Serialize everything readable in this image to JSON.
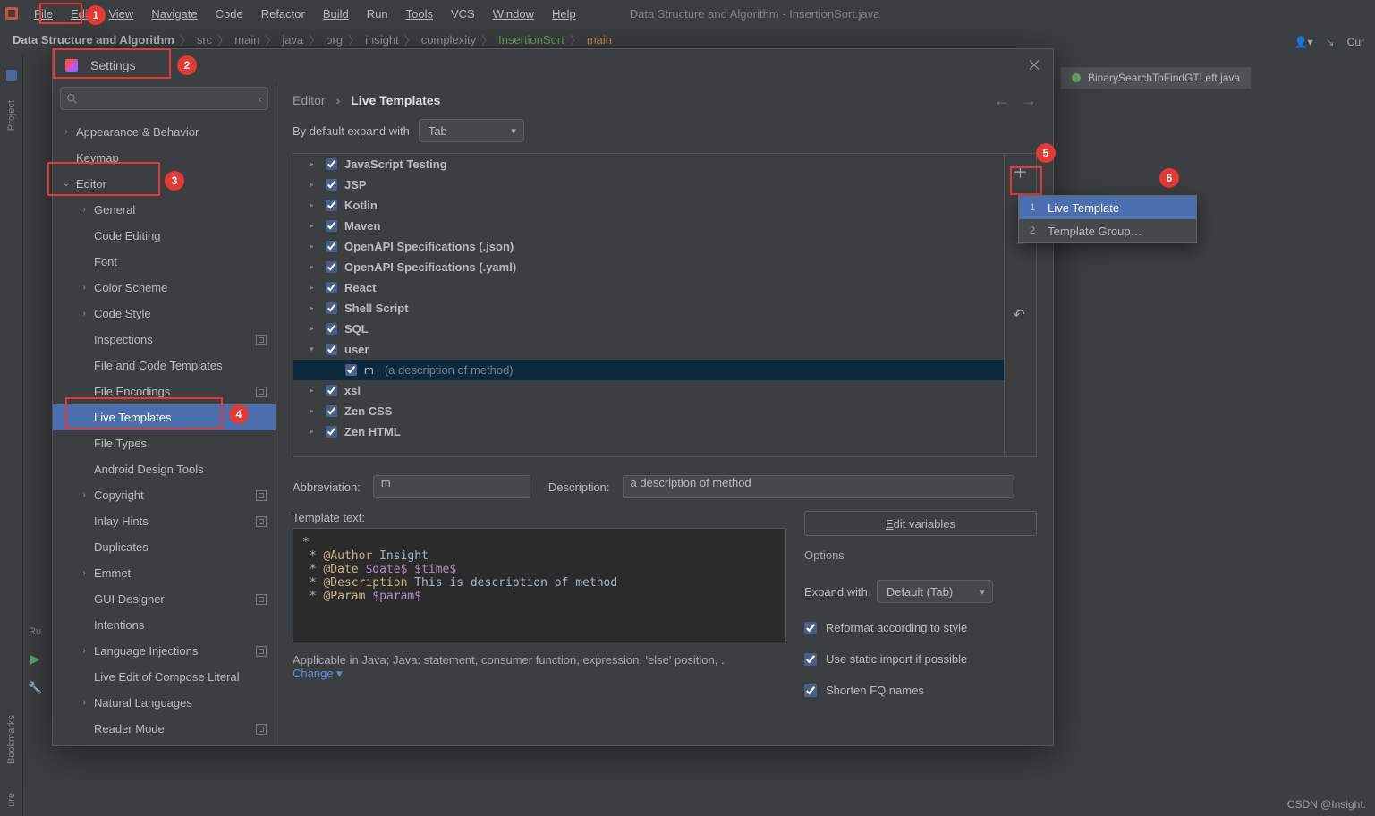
{
  "window_title": "Data Structure and Algorithm - InsertionSort.java",
  "menubar": [
    "File",
    "Edit",
    "View",
    "Navigate",
    "Code",
    "Refactor",
    "Build",
    "Run",
    "Tools",
    "VCS",
    "Window",
    "Help"
  ],
  "menubar_underline_idx": [
    0,
    0,
    0,
    0,
    0,
    4,
    0,
    1,
    0,
    2,
    0,
    0
  ],
  "breadcrumb": [
    "Data Structure and Algorithm",
    "src",
    "main",
    "java",
    "org",
    "insight",
    "complexity",
    "InsertionSort",
    "main"
  ],
  "top_right": {
    "run_label": "Cur"
  },
  "left_rail": {
    "project": "Project",
    "bookmarks": "Bookmarks",
    "structure": "ure"
  },
  "bg_tab": "BinarySearchToFindGTLeft.java",
  "dialog": {
    "title": "Settings",
    "crumb": [
      "Editor",
      "Live Templates"
    ],
    "expand_lbl": "By default expand with",
    "expand_value": "Tab",
    "side_tree": [
      {
        "t": "Appearance & Behavior",
        "l": 0,
        "c": "›"
      },
      {
        "t": "Keymap",
        "l": 0,
        "c": ""
      },
      {
        "t": "Editor",
        "l": 0,
        "c": "⌄"
      },
      {
        "t": "General",
        "l": 1,
        "c": "›"
      },
      {
        "t": "Code Editing",
        "l": 1,
        "c": ""
      },
      {
        "t": "Font",
        "l": 1,
        "c": ""
      },
      {
        "t": "Color Scheme",
        "l": 1,
        "c": "›"
      },
      {
        "t": "Code Style",
        "l": 1,
        "c": "›"
      },
      {
        "t": "Inspections",
        "l": 1,
        "c": "",
        "sq": true
      },
      {
        "t": "File and Code Templates",
        "l": 1,
        "c": ""
      },
      {
        "t": "File Encodings",
        "l": 1,
        "c": "",
        "sq": true
      },
      {
        "t": "Live Templates",
        "l": 1,
        "c": "",
        "sel": true
      },
      {
        "t": "File Types",
        "l": 1,
        "c": ""
      },
      {
        "t": "Android Design Tools",
        "l": 1,
        "c": ""
      },
      {
        "t": "Copyright",
        "l": 1,
        "c": "›",
        "sq": true
      },
      {
        "t": "Inlay Hints",
        "l": 1,
        "c": "",
        "sq": true
      },
      {
        "t": "Duplicates",
        "l": 1,
        "c": ""
      },
      {
        "t": "Emmet",
        "l": 1,
        "c": "›"
      },
      {
        "t": "GUI Designer",
        "l": 1,
        "c": "",
        "sq": true
      },
      {
        "t": "Intentions",
        "l": 1,
        "c": ""
      },
      {
        "t": "Language Injections",
        "l": 1,
        "c": "›",
        "sq": true
      },
      {
        "t": "Live Edit of Compose Literal",
        "l": 1,
        "c": ""
      },
      {
        "t": "Natural Languages",
        "l": 1,
        "c": "›"
      },
      {
        "t": "Reader Mode",
        "l": 1,
        "c": "",
        "sq": true
      }
    ],
    "template_groups": [
      {
        "t": "JavaScript Testing",
        "c": "›"
      },
      {
        "t": "JSP",
        "c": "›"
      },
      {
        "t": "Kotlin",
        "c": "›"
      },
      {
        "t": "Maven",
        "c": "›"
      },
      {
        "t": "OpenAPI Specifications (.json)",
        "c": "›"
      },
      {
        "t": "OpenAPI Specifications (.yaml)",
        "c": "›"
      },
      {
        "t": "React",
        "c": "›"
      },
      {
        "t": "Shell Script",
        "c": "›"
      },
      {
        "t": "SQL",
        "c": "›"
      },
      {
        "t": "user",
        "c": "⌄"
      },
      {
        "t": "m",
        "desc": "(a description of method)",
        "c": "",
        "child": true,
        "sel": true
      },
      {
        "t": "xsl",
        "c": "›"
      },
      {
        "t": "Zen CSS",
        "c": "›"
      },
      {
        "t": "Zen HTML",
        "c": "›"
      }
    ],
    "popup": [
      {
        "n": "1",
        "t": "Live Template",
        "sel": true
      },
      {
        "n": "2",
        "t": "Template Group…"
      }
    ],
    "form": {
      "abbr_lbl": "Abbreviation:",
      "abbr_val": "m",
      "desc_lbl": "Description:",
      "desc_val": "a description of method",
      "tt_lbl": "Template text:",
      "edit_vars": "Edit variables",
      "options_title": "Options",
      "expand_with_lbl": "Expand with",
      "expand_with_val": "Default (Tab)",
      "chk1": "Reformat according to style",
      "chk2": "Use static import if possible",
      "chk3": "Shorten FQ names",
      "applicable": "Applicable in Java; Java: statement, consumer function, expression, 'else' position, .",
      "change": "Change"
    }
  },
  "watermark": "CSDN @Insight.",
  "code": {
    "l0": "*",
    "l1a": " * ",
    "l1b": "@Author",
    "l1c": " Insight",
    "l2a": " * ",
    "l2b": "@Date ",
    "l2c": "$date$",
    "l2d": " ",
    "l2e": "$time$",
    "l3a": " * ",
    "l3b": "@Description",
    "l3c": " This is description of method",
    "l4a": " * ",
    "l4b": "@Param ",
    "l4c": "$param$"
  },
  "run_hint": "Ru"
}
